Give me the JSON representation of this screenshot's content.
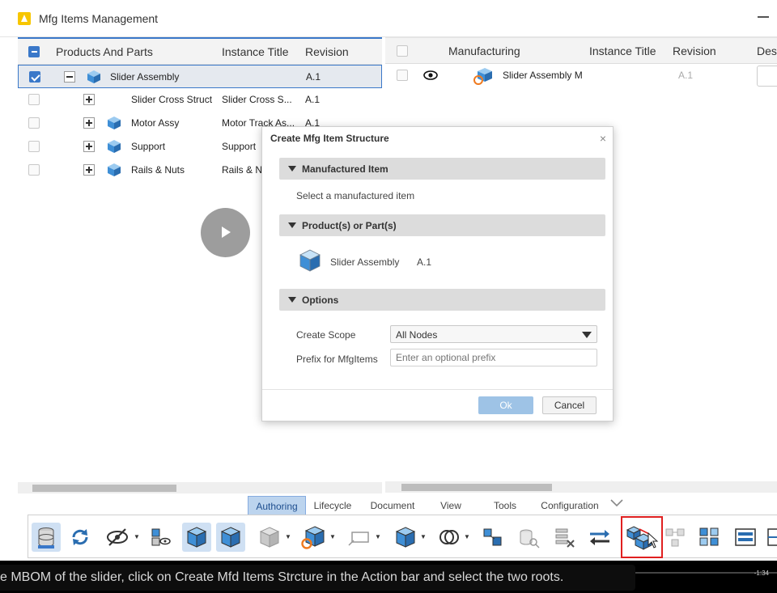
{
  "app": {
    "title": "Mfg Items Management"
  },
  "left_grid": {
    "headers": [
      "Products And Parts",
      "Instance Title",
      "Revision"
    ],
    "rows": [
      {
        "name": "Slider Assembly",
        "instance": "",
        "revision": "A.1"
      },
      {
        "name": "Slider Cross Struct",
        "instance": "Slider Cross S...",
        "revision": "A.1"
      },
      {
        "name": "Motor Assy",
        "instance": "Motor Track As...",
        "revision": "A.1"
      },
      {
        "name": "Support",
        "instance": "Support",
        "revision": "A.1"
      },
      {
        "name": "Rails & Nuts",
        "instance": "Rails & N",
        "revision": "A.1"
      }
    ]
  },
  "right_grid": {
    "headers": [
      "Manufacturing",
      "Instance Title",
      "Revision",
      "Des"
    ],
    "rows": [
      {
        "name": "Slider Assembly M",
        "revision": "A.1"
      }
    ]
  },
  "dialog": {
    "title": "Create Mfg Item Structure",
    "close_glyph": "×",
    "section_manufactured": "Manufactured Item",
    "manufactured_hint": "Select a manufactured item",
    "section_products": "Product(s) or Part(s)",
    "product_name": "Slider Assembly",
    "product_revision": "A.1",
    "section_options": "Options",
    "create_scope_label": "Create Scope",
    "create_scope_value": "All Nodes",
    "prefix_label": "Prefix for MfgItems",
    "prefix_placeholder": "Enter an optional prefix",
    "ok_label": "Ok",
    "cancel_label": "Cancel"
  },
  "action_bar": {
    "tabs": [
      "Authoring",
      "Lifecycle",
      "Document",
      "View",
      "Tools",
      "Configuration"
    ],
    "active_tab": "Authoring"
  },
  "video": {
    "caption": "e MBOM of the slider, click on Create Mfd Items Strcture in the Action bar and select the two roots.",
    "time": "-1:34",
    "progress": 0.055
  },
  "colors": {
    "accent": "#3a78c9",
    "highlight": "#e02020",
    "cube_blue": "#3f8fd6"
  }
}
